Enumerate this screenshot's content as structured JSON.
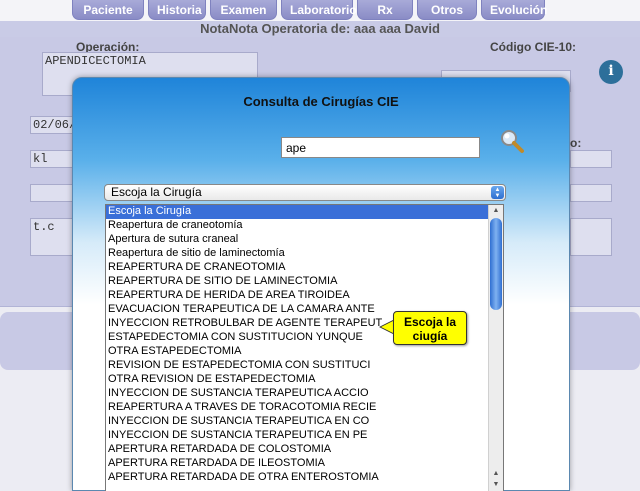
{
  "tabs": [
    "Paciente",
    "Historia",
    "Examen",
    "Laboratorio",
    "Rx",
    "Otros",
    "Evolución"
  ],
  "page_title": "NotaNota Operatoria de:  aaa aaa David",
  "background": {
    "operacion_label": "Operación:",
    "operacion_value": "APENDICECTOMIA",
    "codigo_label": "Código CIE-10:",
    "date_value": "02/06/",
    "field_kl": "kl",
    "field_tc": "t.c",
    "partial_label": "o:"
  },
  "modal": {
    "title": "Consulta de Cirugías CIE",
    "search_value": "ape",
    "select_value": "Escoja la Cirugía",
    "options": [
      "Escoja la Cirugía",
      "Reapertura de craneotomía",
      "Apertura de sutura craneal",
      "Reapertura de sitio de laminectomía",
      "REAPERTURA DE CRANEOTOMIA",
      "REAPERTURA DE SITIO DE LAMINECTOMIA",
      "REAPERTURA DE HERIDA DE AREA TIROIDEA",
      "EVACUACION TERAPEUTICA DE LA CAMARA ANTE",
      "INYECCION RETROBULBAR DE AGENTE TERAPEUT",
      "ESTAPEDECTOMIA CON SUSTITUCION YUNQUE",
      "OTRA ESTAPEDECTOMIA",
      "REVISION DE ESTAPEDECTOMIA CON SUSTITUCI",
      "OTRA REVISION DE ESTAPEDECTOMIA",
      "INYECCION DE SUSTANCIA TERAPEUTICA ACCIO",
      "REAPERTURA A TRAVES DE TORACOTOMIA RECIE",
      "INYECCION DE SUSTANCIA TERAPEUTICA EN CO",
      "INYECCION DE SUSTANCIA TERAPEUTICA EN PE",
      "APERTURA RETARDADA DE COLOSTOMIA",
      "APERTURA RETARDADA DE ILEOSTOMIA",
      "APERTURA RETARDADA DE OTRA ENTEROSTOMIA"
    ],
    "tooltip": "Escoja la ciugía"
  },
  "colors": {
    "selected": "#3a6fd8",
    "tooltip": "#ffff00",
    "tab": "#9a9cd0"
  }
}
